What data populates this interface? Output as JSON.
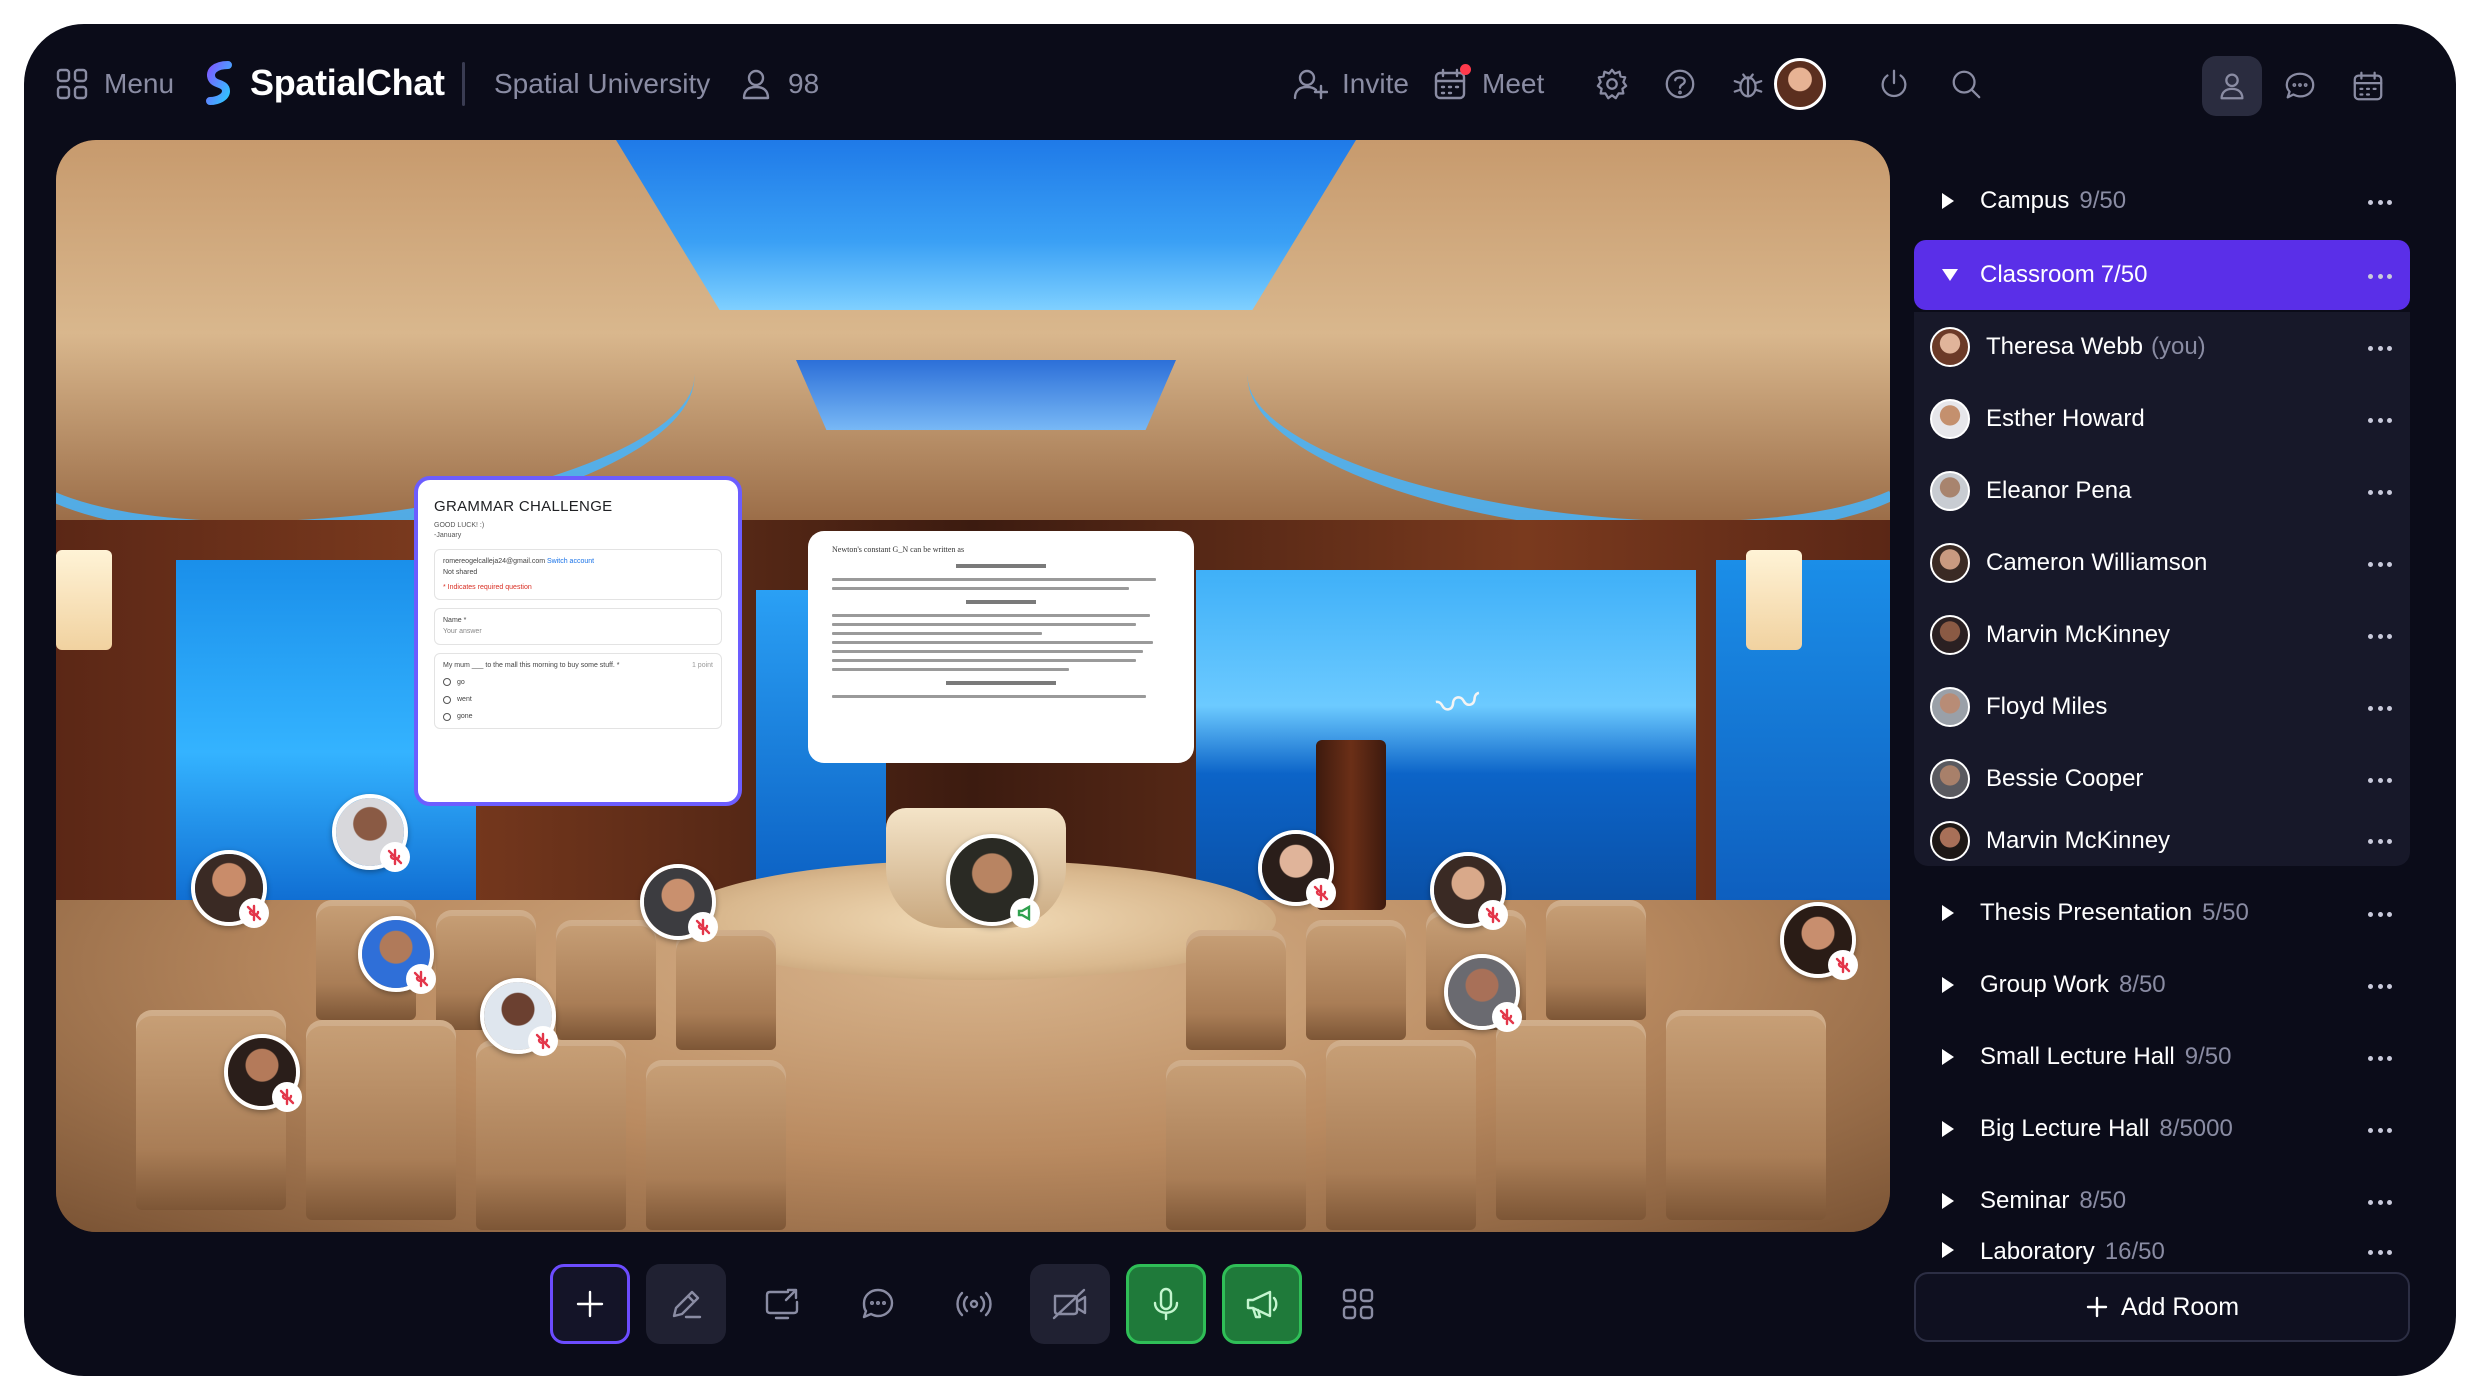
{
  "header": {
    "menu_label": "Menu",
    "brand_name": "SpatialChat",
    "workspace": "Spatial University",
    "participants_count": "98",
    "invite_label": "Invite",
    "meet_label": "Meet"
  },
  "rooms_top": [
    {
      "name": "Campus",
      "count": "9/50"
    }
  ],
  "active_room": {
    "name": "Classroom",
    "count": "7/50"
  },
  "members": [
    {
      "name": "Theresa Webb",
      "suffix": "(you)",
      "color": "#c98c6a"
    },
    {
      "name": "Esther Howard",
      "suffix": "",
      "color": "#a86a4a"
    },
    {
      "name": "Eleanor Pena",
      "suffix": "",
      "color": "#6c6c70"
    },
    {
      "name": "Cameron Williamson",
      "suffix": "",
      "color": "#8a5a44"
    },
    {
      "name": "Marvin McKinney",
      "suffix": "",
      "color": "#5e4036"
    },
    {
      "name": "Floyd Miles",
      "suffix": "",
      "color": "#807a78"
    },
    {
      "name": "Bessie Cooper",
      "suffix": "",
      "color": "#6b5a52"
    },
    {
      "name": "Marvin McKinney",
      "suffix": "",
      "color": "#4a3830"
    }
  ],
  "rooms_bottom": [
    {
      "name": "Thesis Presentation",
      "count": "5/50"
    },
    {
      "name": "Group Work",
      "count": "8/50"
    },
    {
      "name": "Small Lecture Hall",
      "count": "9/50"
    },
    {
      "name": "Big Lecture Hall",
      "count": "8/5000"
    },
    {
      "name": "Seminar",
      "count": "8/50"
    },
    {
      "name": "Laboratory",
      "count": "16/50"
    }
  ],
  "add_room_label": "Add Room",
  "form_panel": {
    "title": "GRAMMAR CHALLENGE",
    "subtitle": "GOOD LUCK! :)",
    "subtitle2": "-January",
    "email": "romereogelcalleja24@gmail.com",
    "switch_account": "Switch account",
    "not_shared": "Not shared",
    "required_note": "* Indicates required question",
    "name_label": "Name *",
    "answer_placeholder": "Your answer",
    "question": "My mum ___ to the mall this morning to buy some stuff. *",
    "points": "1 point",
    "options": [
      "go",
      "went",
      "gone"
    ]
  },
  "paper_panel": {
    "line1": "Newton's constant G_N can be written as"
  },
  "colors": {
    "accent": "#5a2fe8",
    "background": "#0b0c19",
    "sidebar_box": "#171829",
    "mute_red": "#e3364a",
    "active_green": "#2fbf57"
  },
  "icons": {
    "menu": "grid-icon",
    "participants": "user-icon",
    "invite": "user-plus-icon",
    "meet": "calendar-icon",
    "settings": "gear-icon",
    "help": "question-icon",
    "bug": "bug-icon",
    "power": "power-icon",
    "search": "search-icon",
    "people_tab": "person-icon",
    "chat_tab": "chat-icon",
    "calendar_tab": "calendar-icon"
  }
}
